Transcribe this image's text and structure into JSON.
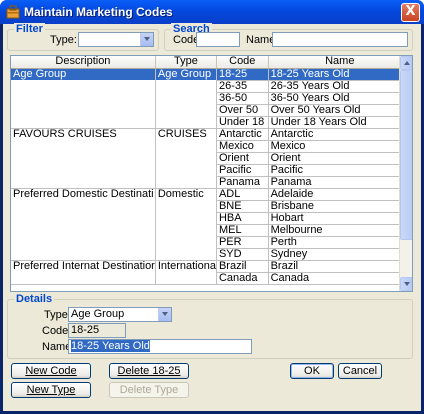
{
  "window": {
    "title": "Maintain Marketing Codes",
    "close_label": "X"
  },
  "filter": {
    "title": "Filter",
    "type_label": "Type:",
    "type_value": ""
  },
  "search": {
    "title": "Search",
    "code_label": "Code:",
    "code_value": "",
    "name_label": "Name:",
    "name_value": ""
  },
  "grid": {
    "columns": [
      "Description",
      "Type",
      "Code",
      "Name"
    ],
    "groups": [
      {
        "description": "Age Group",
        "type": "Age Group",
        "rows": [
          [
            "18-25",
            "18-25 Years Old"
          ],
          [
            "26-35",
            "26-35 Years Old"
          ],
          [
            "36-50",
            "36-50 Years Old"
          ],
          [
            "Over 50",
            "Over 50 Years Old"
          ],
          [
            "Under 18",
            "Under 18 Years Old"
          ]
        ]
      },
      {
        "description": "FAVOURS CRUISES",
        "type": "CRUISES",
        "rows": [
          [
            "Antarctic",
            "Antarctic"
          ],
          [
            "Mexico",
            "Mexico"
          ],
          [
            "Orient",
            "Orient"
          ],
          [
            "Pacific",
            "Pacific"
          ],
          [
            "Panama",
            "Panama"
          ]
        ]
      },
      {
        "description": "Preferred Domestic Destinati",
        "type": "Domestic",
        "rows": [
          [
            "ADL",
            "Adelaide"
          ],
          [
            "BNE",
            "Brisbane"
          ],
          [
            "HBA",
            "Hobart"
          ],
          [
            "MEL",
            "Melbourne"
          ],
          [
            "PER",
            "Perth"
          ],
          [
            "SYD",
            "Sydney"
          ]
        ]
      },
      {
        "description": "Preferred Internat Destinatior",
        "type": "Internationa",
        "rows": [
          [
            "Brazil",
            "Brazil"
          ],
          [
            "Canada",
            "Canada"
          ]
        ]
      }
    ],
    "selected_row": 0
  },
  "details": {
    "title": "Details",
    "type_label": "Type:",
    "type_value": "Age Group",
    "code_label": "Code:",
    "code_value": "18-25",
    "name_label": "Name:",
    "name_value": "18-25 Years Old"
  },
  "buttons": {
    "new_code": "New Code",
    "delete_code": "Delete 18-25",
    "ok": "OK",
    "cancel": "Cancel",
    "new_type": "New Type",
    "delete_type": "Delete Type"
  },
  "colors": {
    "title_bar": "#0348de",
    "selection": "#316ac5",
    "group_title": "#0046d5",
    "dialog_bg": "#ece9d8"
  }
}
